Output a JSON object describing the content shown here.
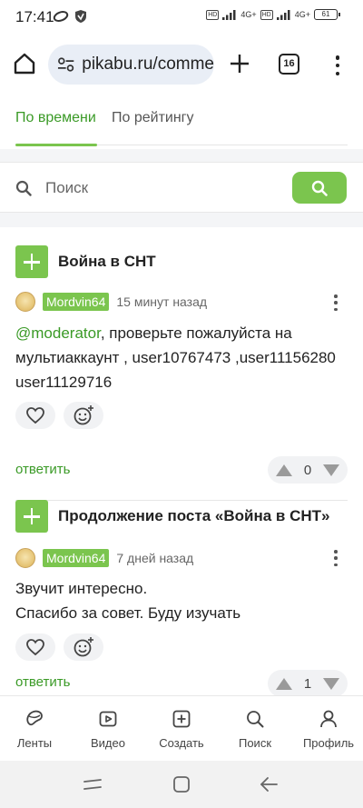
{
  "status_bar": {
    "time": "17:41",
    "network_1": "4G+",
    "network_2": "4G+",
    "hd_1": "HD",
    "hd_2": "HD",
    "battery": "61"
  },
  "browser": {
    "url": "pikabu.ru/comme",
    "tabs_count": "16"
  },
  "sort_tabs": [
    {
      "label": "По времени",
      "active": true
    },
    {
      "label": "По рейтингу",
      "active": false
    }
  ],
  "search": {
    "placeholder": "Поиск"
  },
  "comments": [
    {
      "post_title": "Война в СНТ",
      "author": "Mordvin64",
      "time": "15 минут назад",
      "mention": "@moderator",
      "text_after_mention": ", проверьте пожалуйста на мультиаккаунт , user10767473 ,user11156280 user11129716",
      "reply_label": "ответить",
      "rating": "0"
    },
    {
      "post_title": "Продолжение поста «Война в СНТ»",
      "author": "Mordvin64",
      "time": "7 дней назад",
      "text_line_1": "Звучит интересно.",
      "text_line_2": "Спасибо за совет. Буду изучать",
      "reply_label": "ответить",
      "rating": "1"
    }
  ],
  "bottom_nav": [
    {
      "label": "Ленты",
      "icon": "feeds-icon"
    },
    {
      "label": "Видео",
      "icon": "video-icon"
    },
    {
      "label": "Создать",
      "icon": "create-icon"
    },
    {
      "label": "Поиск",
      "icon": "search-icon"
    },
    {
      "label": "Профиль",
      "icon": "profile-icon"
    }
  ],
  "colors": {
    "accent_green": "#7bc54e",
    "link_green": "#3a9a26",
    "url_box_bg": "#e9eef6"
  }
}
